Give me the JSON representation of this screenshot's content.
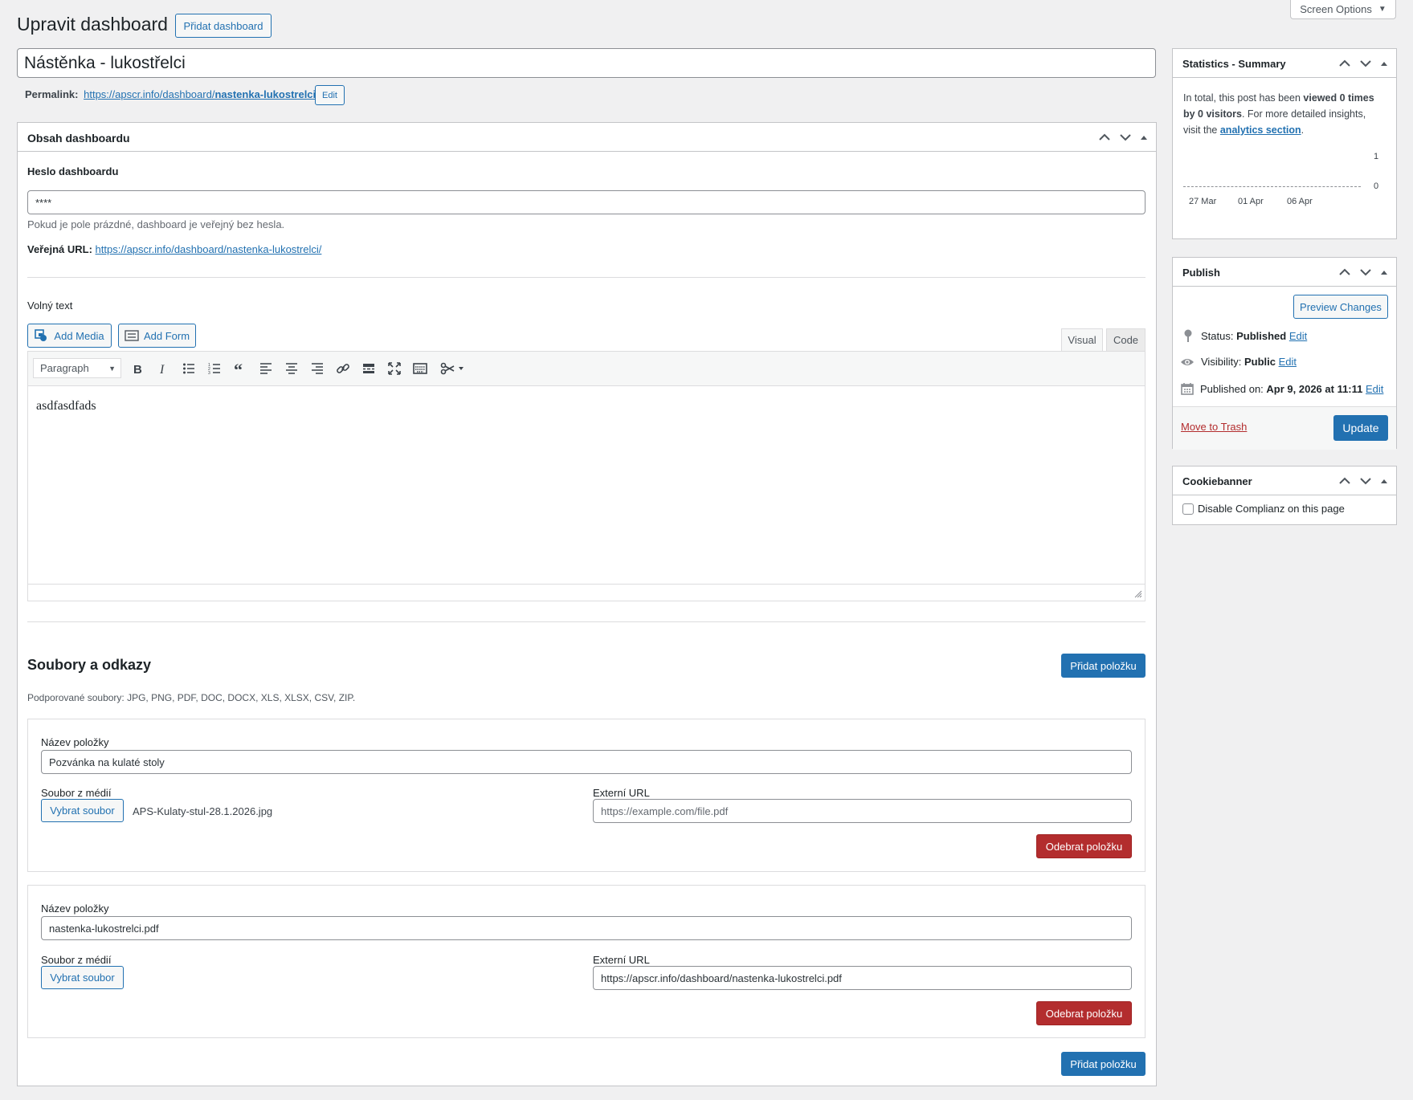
{
  "header": {
    "title": "Upravit dashboard",
    "add_button": "Přidat dashboard",
    "screen_options": "Screen Options"
  },
  "post": {
    "title": "Nástěnka - lukostřelci",
    "permalink_label": "Permalink:",
    "permalink_base": "https://apscr.info/dashboard/",
    "permalink_slug": "nastenka-lukostrelci",
    "permalink_tail": "/",
    "permalink_edit": "Edit"
  },
  "content_box": {
    "title": "Obsah dashboardu",
    "password_label": "Heslo dashboardu",
    "password_value": "****",
    "password_hint": "Pokud je pole prázdné, dashboard je veřejný bez hesla.",
    "public_url_label": "Veřejná URL:",
    "public_url": "https://apscr.info/dashboard/nastenka-lukostrelci/",
    "free_text_label": "Volný text"
  },
  "editor": {
    "add_media": "Add Media",
    "add_form": "Add Form",
    "tab_visual": "Visual",
    "tab_code": "Code",
    "format_select": "Paragraph",
    "content": "asdfasdfads"
  },
  "files": {
    "title": "Soubory a odkazy",
    "add_item": "Přidat položku",
    "supported": "Podporované soubory: JPG, PNG, PDF, DOC, DOCX, XLS, XLSX, CSV, ZIP.",
    "items": [
      {
        "name_label": "Název položky",
        "name": "Pozvánka na kulaté stoly",
        "media_label": "Soubor z médií",
        "choose": "Vybrat soubor",
        "file": "APS-Kulaty-stul-28.1.2026.jpg",
        "ext_label": "Externí URL",
        "ext_value": "",
        "ext_placeholder": "https://example.com/file.pdf",
        "remove": "Odebrat položku"
      },
      {
        "name_label": "Název položky",
        "name": "nastenka-lukostrelci.pdf",
        "media_label": "Soubor z médií",
        "choose": "Vybrat soubor",
        "file": "",
        "ext_label": "Externí URL",
        "ext_value": "https://apscr.info/dashboard/nastenka-lukostrelci.pdf",
        "ext_placeholder": "",
        "remove": "Odebrat položku"
      }
    ]
  },
  "stats": {
    "title": "Statistics - Summary",
    "text_a": "In total, this post has been ",
    "text_b": "viewed 0 times",
    "text_c": "by 0 visitors",
    "text_d": ". For more detailed insights, visit the ",
    "link": "analytics section",
    "text_e": ".",
    "y_max": "1",
    "y_min": "0",
    "dates": [
      "27 Mar",
      "01 Apr",
      "06 Apr"
    ]
  },
  "publish": {
    "title": "Publish",
    "preview": "Preview Changes",
    "status_label": "Status: ",
    "status_value": "Published",
    "visibility_label": "Visibility: ",
    "visibility_value": "Public",
    "published_label": "Published on: ",
    "published_value": "Apr 9, 2026 at 11:11",
    "edit": "Edit",
    "trash": "Move to Trash",
    "update": "Update"
  },
  "cookie": {
    "title": "Cookiebanner",
    "checkbox_label": "Disable Complianz on this page"
  }
}
